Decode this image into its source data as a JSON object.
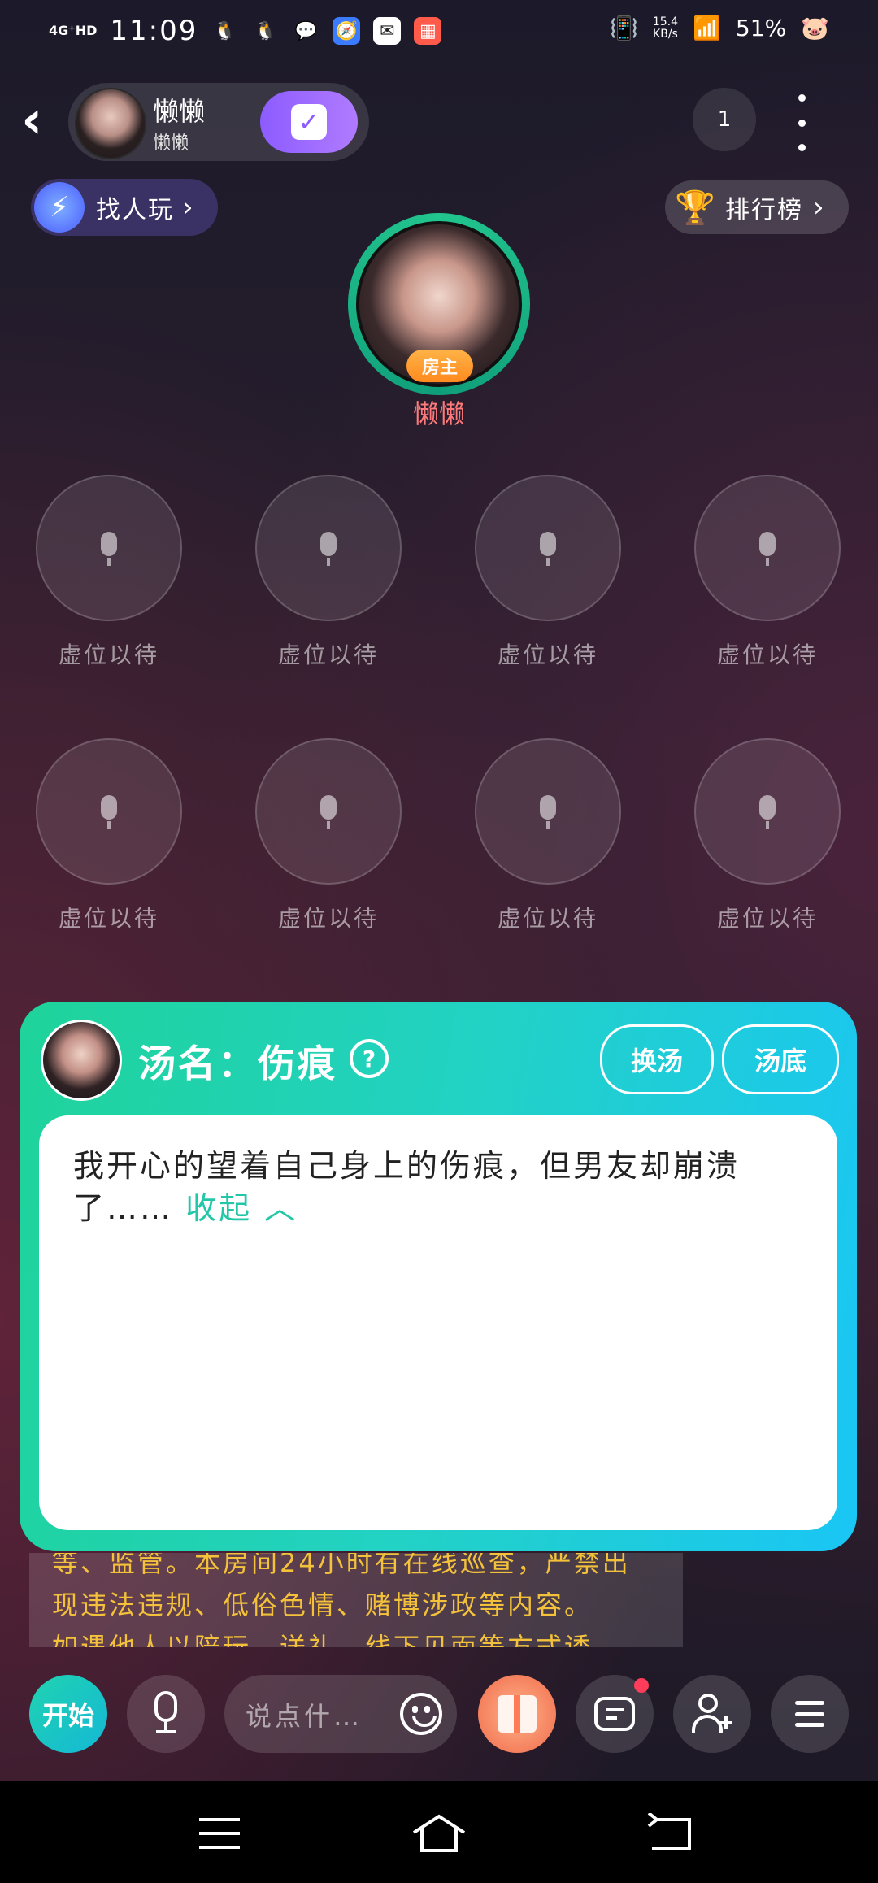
{
  "status_bar": {
    "network": "4G⁺HD",
    "time": "11:09",
    "speed_value": "15.4",
    "speed_unit": "KB/s",
    "battery": "51%"
  },
  "header": {
    "host_name": "懒懒",
    "host_sub": "懒懒",
    "count": "1"
  },
  "find_button": {
    "label": "找人玩"
  },
  "rank_button": {
    "label": "排行榜"
  },
  "room_host": {
    "badge": "房主",
    "name": "懒懒"
  },
  "seats": [
    {
      "label": "虚位以待"
    },
    {
      "label": "虚位以待"
    },
    {
      "label": "虚位以待"
    },
    {
      "label": "虚位以待"
    },
    {
      "label": "虚位以待"
    },
    {
      "label": "虚位以待"
    },
    {
      "label": "虚位以待"
    },
    {
      "label": "虚位以待"
    }
  ],
  "topic_card": {
    "title": "汤名：伤痕",
    "help": "?",
    "change_button": "换汤",
    "answer_button": "汤底",
    "content": "我开心的望着自己身上的伤痕，但男友却崩溃了……",
    "collapse": "收起"
  },
  "notice": {
    "lines": [
      "等、监管。本房间24小时有在线巡查，严禁出",
      "现违法违规、低俗色情、赌博涉政等内容。",
      "如遇他人以陪玩、送礼、线下见面等方式诱"
    ]
  },
  "toolbar": {
    "start": "开始",
    "say_placeholder": "说点什…"
  },
  "colors": {
    "accent_green": "#1fd39a",
    "accent_blue": "#1ac6f5",
    "notice_text": "#f3c23a",
    "host_name": "#ff7a7a"
  }
}
